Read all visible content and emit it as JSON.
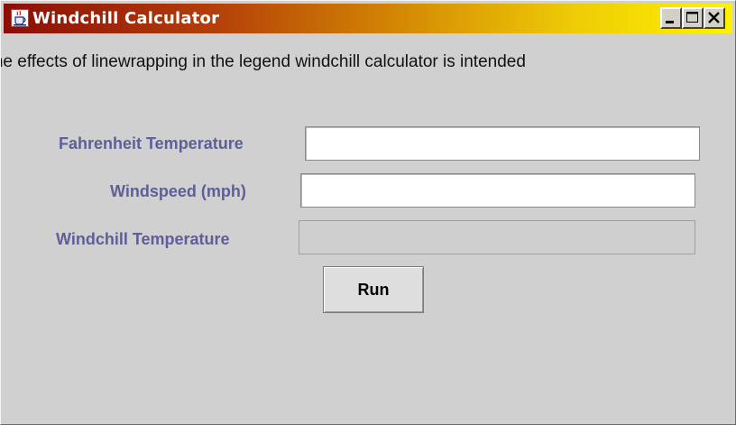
{
  "window": {
    "title": "Windchill Calculator",
    "controls": {
      "minimize": "minimize",
      "maximize": "maximize",
      "close": "close"
    }
  },
  "legend": {
    "text": "ow the effects of linewrapping in the legend windchill calculator is intended"
  },
  "form": {
    "fahrenheit_label": "Fahrenheit Temperature",
    "fahrenheit_value": "",
    "windspeed_label": "Windspeed (mph)",
    "windspeed_value": "",
    "windchill_label": "Windchill Temperature",
    "windchill_value": "",
    "run_label": "Run"
  },
  "colors": {
    "label": "#5e5e9a",
    "background": "#d0d0d0",
    "title_gradient_start": "#8b0e07",
    "title_gradient_end": "#fff200"
  },
  "icons": {
    "app": "java-coffee-cup-icon",
    "minimize": "minimize-icon",
    "maximize": "maximize-icon",
    "close": "close-icon"
  }
}
